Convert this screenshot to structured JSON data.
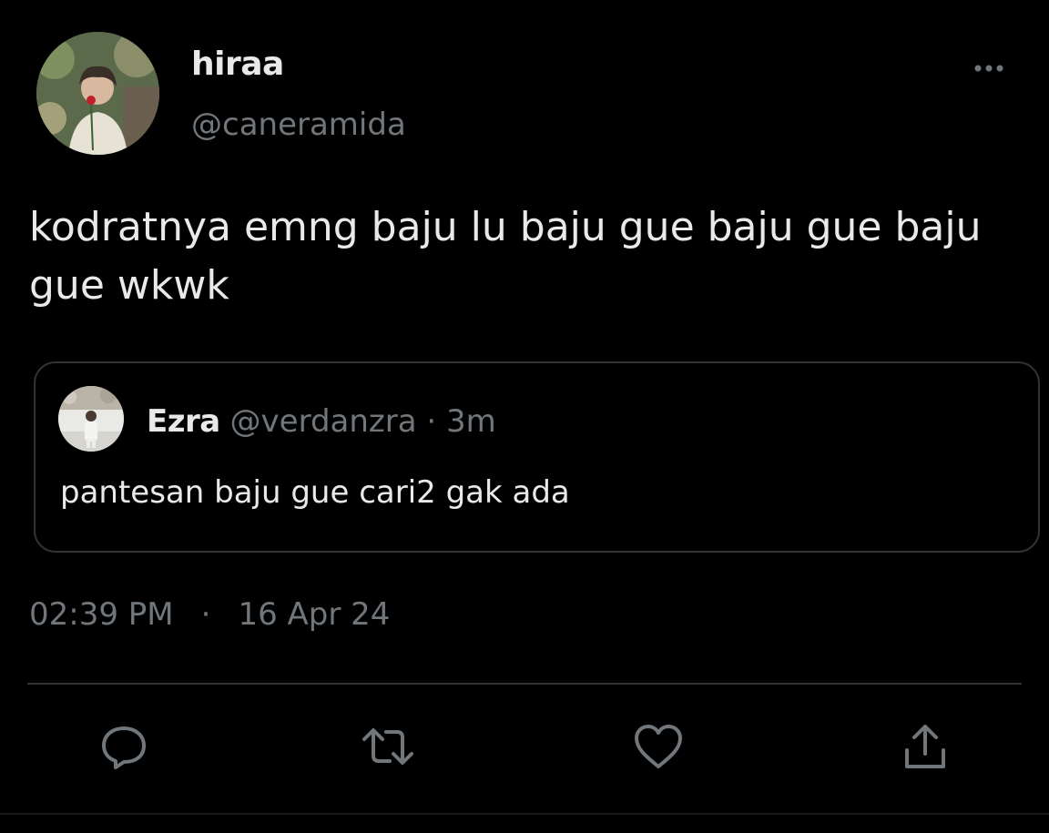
{
  "tweet": {
    "author": {
      "display_name": "hiraa",
      "handle": "@caneramida",
      "avatar": "avatar-man-with-rose"
    },
    "more_icon": "more-horizontal-icon",
    "text": "kodratnya emng baju lu baju gue baju gue baju gue wkwk",
    "quoted": {
      "display_name": "Ezra",
      "handle": "@verdanzra",
      "separator": "·",
      "time": "3m",
      "text": "pantesan baju gue cari2 gak ada",
      "avatar": "avatar-man-standing"
    },
    "meta": {
      "time": "02:39 PM",
      "separator": "·",
      "date": "16 Apr 24"
    },
    "actions": [
      {
        "icon": "reply-icon"
      },
      {
        "icon": "retweet-icon"
      },
      {
        "icon": "like-icon"
      },
      {
        "icon": "share-icon"
      }
    ]
  },
  "colors": {
    "background": "#000000",
    "primary_text": "#e7e9ea",
    "secondary_text": "#71767b",
    "border": "#2f3336"
  }
}
